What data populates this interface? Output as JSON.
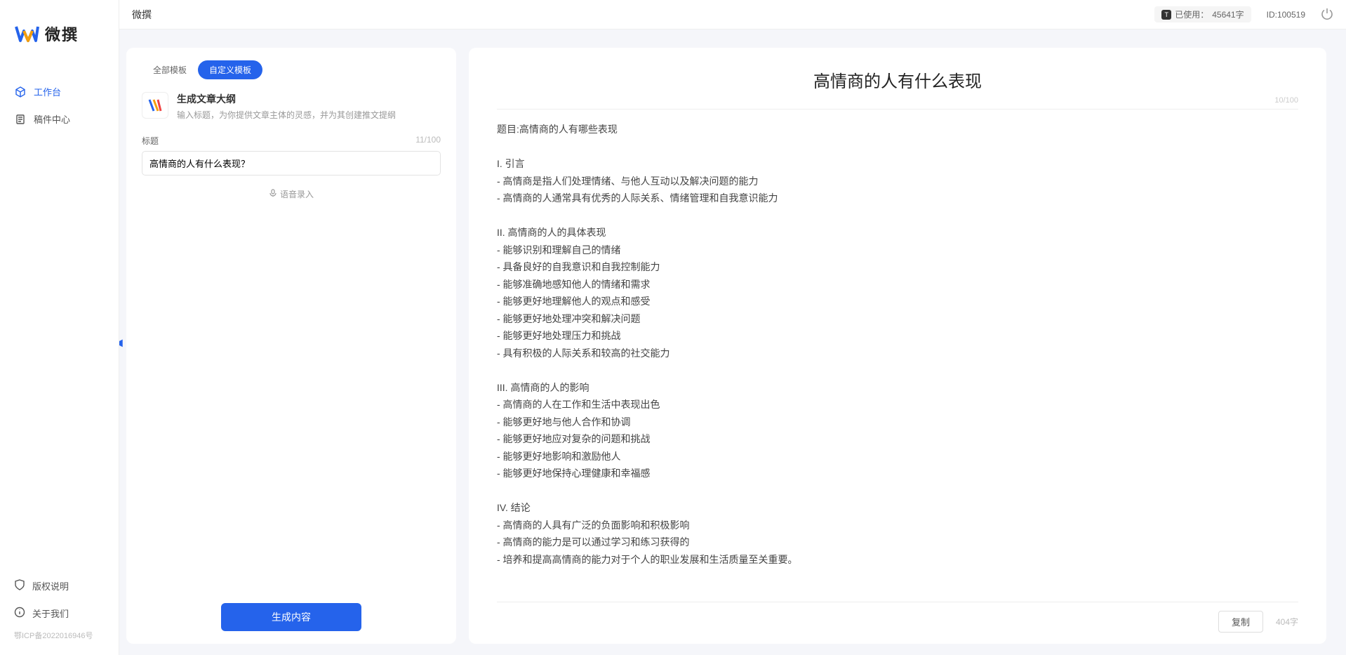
{
  "brand": "微撰",
  "nav": {
    "workspace": "工作台",
    "drafts": "稿件中心",
    "copyright": "版权说明",
    "about": "关于我们",
    "icp": "鄂ICP备2022016946号"
  },
  "topbar": {
    "title": "微撰",
    "usage_label": "已使用：",
    "usage_value": "45641字",
    "id_label": "ID:",
    "id_value": "100519"
  },
  "tabs": {
    "all": "全部模板",
    "custom": "自定义模板"
  },
  "template": {
    "title": "生成文章大纲",
    "desc": "输入标题，为你提供文章主体的灵感，并为其创建推文提纲"
  },
  "form": {
    "title_label": "标题",
    "title_counter": "11/100",
    "title_value": "高情商的人有什么表现？",
    "voice_label": "语音录入",
    "generate": "生成内容"
  },
  "output": {
    "title": "高情商的人有什么表现",
    "title_counter": "10/100",
    "body": "题目:高情商的人有哪些表现\n\nI. 引言\n- 高情商是指人们处理情绪、与他人互动以及解决问题的能力\n- 高情商的人通常具有优秀的人际关系、情绪管理和自我意识能力\n\nII. 高情商的人的具体表现\n- 能够识别和理解自己的情绪\n- 具备良好的自我意识和自我控制能力\n- 能够准确地感知他人的情绪和需求\n- 能够更好地理解他人的观点和感受\n- 能够更好地处理冲突和解决问题\n- 能够更好地处理压力和挑战\n- 具有积极的人际关系和较高的社交能力\n\nIII. 高情商的人的影响\n- 高情商的人在工作和生活中表现出色\n- 能够更好地与他人合作和协调\n- 能够更好地应对复杂的问题和挑战\n- 能够更好地影响和激励他人\n- 能够更好地保持心理健康和幸福感\n\nIV. 结论\n- 高情商的人具有广泛的负面影响和积极影响\n- 高情商的能力是可以通过学习和练习获得的\n- 培养和提高高情商的能力对于个人的职业发展和生活质量至关重要。",
    "copy": "复制",
    "word_count": "404字"
  }
}
